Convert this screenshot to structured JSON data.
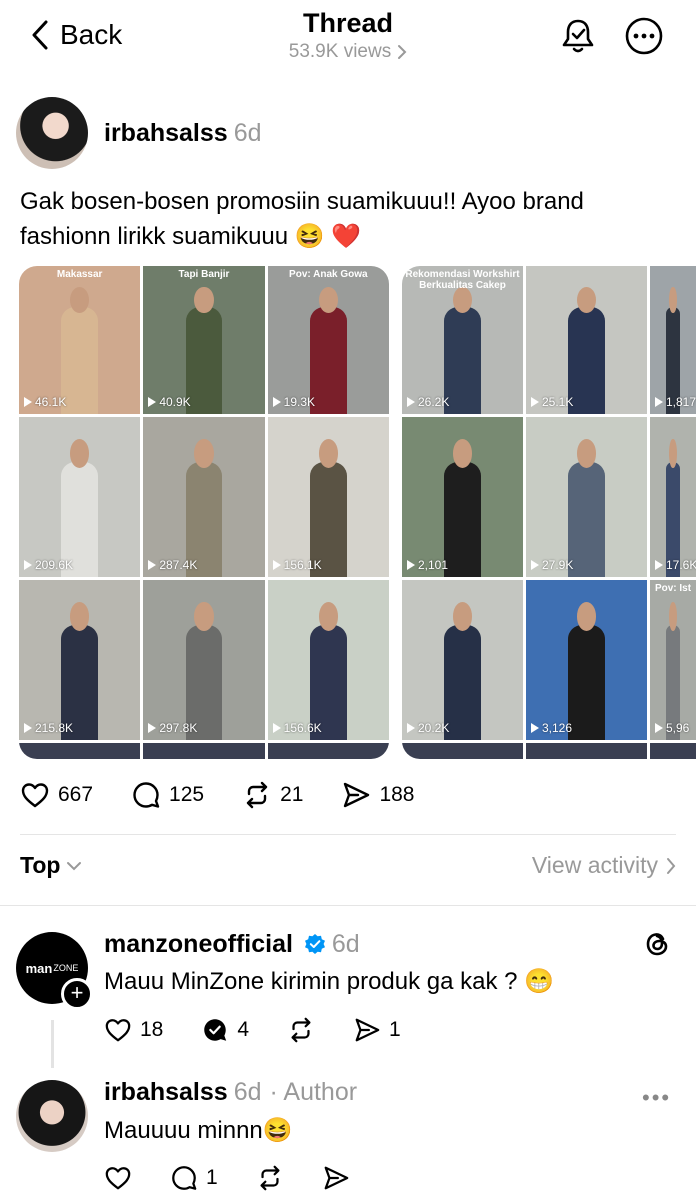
{
  "header": {
    "back_label": "Back",
    "title": "Thread",
    "views": "53.9K views"
  },
  "post": {
    "username": "irbahsalss",
    "time": "6d",
    "text": "Gak bosen-bosen promosiin suamikuuu!! Ayoo brand fashionn lirikk suamikuuu 😆 ❤️",
    "media_1": {
      "tiles": [
        {
          "caption": "Makassar",
          "count": "46.1K",
          "bg": "#cfa98e",
          "shirt": "#d7b692"
        },
        {
          "caption": "Tapi Banjir",
          "count": "40.9K",
          "bg": "#6f7d6a",
          "shirt": "#4b5a3d"
        },
        {
          "caption": "Pov: Anak Gowa",
          "count": "19.3K",
          "bg": "#9a9c9a",
          "shirt": "#7a1f2a"
        },
        {
          "caption": "",
          "count": "209.6K",
          "bg": "#c7c8c3",
          "shirt": "#e0e0dc"
        },
        {
          "caption": "",
          "count": "287.4K",
          "bg": "#a9a79f",
          "shirt": "#8b8470"
        },
        {
          "caption": "",
          "count": "156.1K",
          "bg": "#d5d3cc",
          "shirt": "#5a5344"
        },
        {
          "caption": "",
          "count": "215.8K",
          "bg": "#b8b7b0",
          "shirt": "#2b3144"
        },
        {
          "caption": "",
          "count": "297.8K",
          "bg": "#9ea09a",
          "shirt": "#6b6c6a"
        },
        {
          "caption": "",
          "count": "156.6K",
          "bg": "#c9d0c6",
          "shirt": "#2f3650"
        }
      ]
    },
    "media_2": {
      "tiles": [
        {
          "caption": "Rekomendasi Workshirt Berkualitas Cakep",
          "count": "26.2K",
          "bg": "#b7b9b6",
          "shirt": "#2f3c55"
        },
        {
          "caption": "",
          "count": "25.1K",
          "bg": "#c5c6c1",
          "shirt": "#283452"
        },
        {
          "caption": "",
          "count": "1,817",
          "bg": "#9ea4a8",
          "shirt": "#2d3440"
        },
        {
          "caption": "",
          "count": "2,101",
          "bg": "#788a72",
          "shirt": "#1e1e1e"
        },
        {
          "caption": "",
          "count": "27.9K",
          "bg": "#c8ccc4",
          "shirt": "#566478"
        },
        {
          "caption": "",
          "count": "17.6K",
          "bg": "#b0b3ad",
          "shirt": "#3b4a6a"
        },
        {
          "caption": "",
          "count": "20.2K",
          "bg": "#c4c6c1",
          "shirt": "#263047"
        },
        {
          "caption": "",
          "count": "3,126",
          "bg": "#3e6fb2",
          "shirt": "#1b1b1b"
        },
        {
          "caption": "Pov: Ist",
          "count": "5,96",
          "bg": "#a7aaa5",
          "shirt": "#777a7d"
        }
      ]
    },
    "likes": "667",
    "comments": "125",
    "reposts": "21",
    "shares": "188"
  },
  "section": {
    "sort_label": "Top",
    "view_activity": "View activity"
  },
  "replies": [
    {
      "username": "manzoneofficial",
      "time": "6d",
      "text": "Mauu MinZone kirimin produk ga kak ? 😁",
      "likes": "18",
      "replies": "4",
      "shares": "1",
      "avatar_text": "man",
      "avatar_text2": "ZONE"
    },
    {
      "username": "irbahsalss",
      "time": "6d",
      "author_tag": "· Author",
      "text": "Mauuuu minnn😆",
      "replies": "1"
    }
  ],
  "icons": {
    "back": "chevron-left-icon",
    "bell": "bell-icon",
    "more": "more-icon",
    "like": "heart-icon",
    "comment": "comment-icon",
    "repost": "repost-icon",
    "share": "send-icon",
    "threads": "threads-logo-icon",
    "verified": "verified-badge-icon"
  },
  "colors": {
    "verified": "#0095f6",
    "secondary_text": "#999999"
  }
}
